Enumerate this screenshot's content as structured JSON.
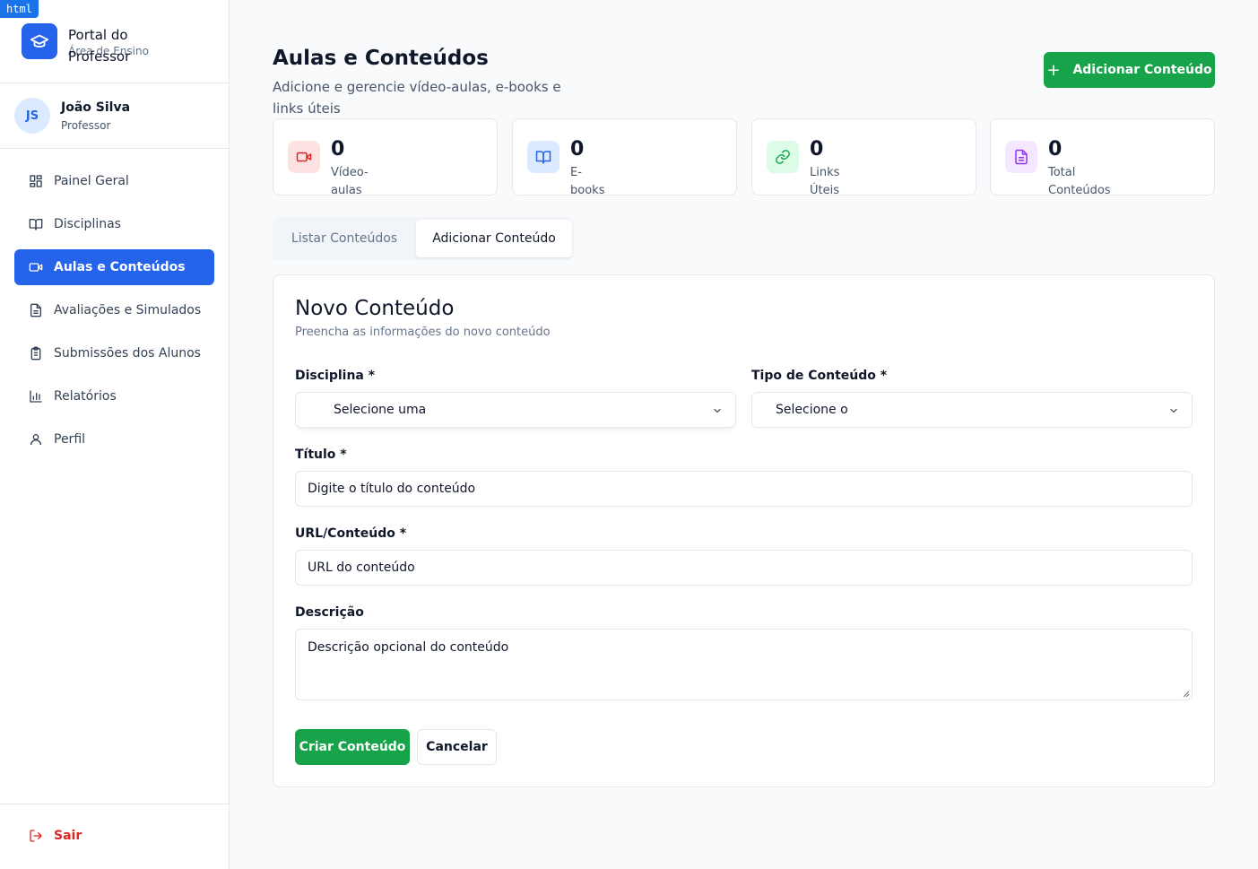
{
  "badge": "html",
  "brand": {
    "title": "Portal do Professor",
    "subtitle": "Área de Ensino"
  },
  "user": {
    "initials": "JS",
    "name": "João Silva",
    "role": "Professor"
  },
  "nav": [
    {
      "label": "Painel Geral",
      "icon": "dashboard-icon"
    },
    {
      "label": "Disciplinas",
      "icon": "book-icon"
    },
    {
      "label": "Aulas e Conteúdos",
      "icon": "video-icon",
      "active": true
    },
    {
      "label": "Avaliações e Simulados",
      "icon": "document-icon"
    },
    {
      "label": "Submissões dos Alunos",
      "icon": "clipboard-icon"
    },
    {
      "label": "Relatórios",
      "icon": "bar-chart-icon"
    },
    {
      "label": "Perfil",
      "icon": "user-icon"
    }
  ],
  "logout": "Sair",
  "header": {
    "title": "Aulas e Conteúdos",
    "subtitle": "Adicione e gerencie vídeo-aulas, e-books e links úteis",
    "add_button": "Adicionar Conteúdo"
  },
  "stats": [
    {
      "value": "0",
      "label": "Vídeo-aulas",
      "icon": "video-icon",
      "color": "#dc2626",
      "bg": "#fee2e2"
    },
    {
      "value": "0",
      "label": "E-books",
      "icon": "book-icon",
      "color": "#2563eb",
      "bg": "#dbeafe"
    },
    {
      "value": "0",
      "label": "Links Úteis",
      "icon": "link-icon",
      "color": "#16a34a",
      "bg": "#dcfce7"
    },
    {
      "value": "0",
      "label": "Total Conteúdos",
      "icon": "document-icon",
      "color": "#9333ea",
      "bg": "#f3e8ff"
    }
  ],
  "tabs": {
    "list": "Listar Conteúdos",
    "add": "Adicionar Conteúdo"
  },
  "form": {
    "title": "Novo Conteúdo",
    "subtitle": "Preencha as informações do novo conteúdo",
    "disciplina_label": "Disciplina *",
    "disciplina_value": "Selecione uma",
    "tipo_label": "Tipo de Conteúdo *",
    "tipo_value": "Selecione o",
    "titulo_label": "Título *",
    "titulo_placeholder": "Digite o título do conteúdo",
    "url_label": "URL/Conteúdo *",
    "url_placeholder": "URL do conteúdo",
    "descricao_label": "Descrição",
    "descricao_placeholder": "Descrição opcional do conteúdo",
    "submit": "Criar Conteúdo",
    "cancel": "Cancelar"
  },
  "colors": {
    "primary": "#2563eb",
    "success": "#16a34a",
    "danger": "#dc2626"
  }
}
